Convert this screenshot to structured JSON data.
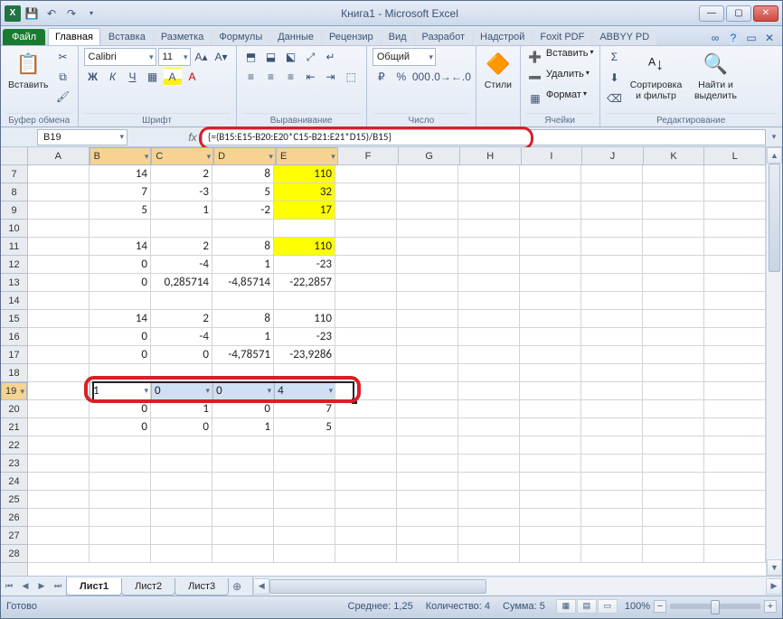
{
  "title": "Книга1 - Microsoft Excel",
  "app_icon_text": "X",
  "tabs": {
    "file": "Файл",
    "items": [
      "Главная",
      "Вставка",
      "Разметка",
      "Формулы",
      "Данные",
      "Рецензир",
      "Вид",
      "Разработ",
      "Надстрой",
      "Foxit PDF",
      "ABBYY PD"
    ],
    "active_index": 0
  },
  "ribbon": {
    "clipboard": {
      "paste": "Вставить",
      "label": "Буфер обмена"
    },
    "font": {
      "family": "Calibri",
      "size": "11",
      "label": "Шрифт"
    },
    "alignment": {
      "label": "Выравнивание"
    },
    "number": {
      "format": "Общий",
      "label": "Число"
    },
    "styles": {
      "btn": "Стили",
      "label": ""
    },
    "cells": {
      "insert": "Вставить",
      "delete": "Удалить",
      "format": "Формат",
      "label": "Ячейки"
    },
    "editing": {
      "sort": "Сортировка и фильтр",
      "find": "Найти и выделить",
      "label": "Редактирование"
    }
  },
  "namebox": "B19",
  "fx": "fx",
  "formula": "{=(B15:E15-B20:E20*C15-B21:E21*D15)/B15}",
  "columns": [
    "A",
    "B",
    "C",
    "D",
    "E",
    "F",
    "G",
    "H",
    "I",
    "J",
    "K",
    "L"
  ],
  "first_row": 7,
  "row_count": 22,
  "chart_data": {
    "type": "table",
    "selected_columns": [
      "B",
      "C",
      "D",
      "E"
    ],
    "selected_row_header": "19",
    "rows": {
      "7": {
        "B": "14",
        "C": "2",
        "D": "8",
        "E": "110",
        "E_yellow": true
      },
      "8": {
        "B": "7",
        "C": "-3",
        "D": "5",
        "E": "32",
        "E_yellow": true
      },
      "9": {
        "B": "5",
        "C": "1",
        "D": "-2",
        "E": "17",
        "E_yellow": true
      },
      "11": {
        "B": "14",
        "C": "2",
        "D": "8",
        "E": "110",
        "E_yellow": true
      },
      "12": {
        "B": "0",
        "C": "-4",
        "D": "1",
        "E": "-23"
      },
      "13": {
        "B": "0",
        "C": "0,285714",
        "D": "-4,85714",
        "E": "-22,2857"
      },
      "15": {
        "B": "14",
        "C": "2",
        "D": "8",
        "E": "110"
      },
      "16": {
        "B": "0",
        "C": "-4",
        "D": "1",
        "E": "-23"
      },
      "17": {
        "B": "0",
        "C": "0",
        "D": "-4,78571",
        "E": "-23,9286"
      },
      "19": {
        "B": "1",
        "C": "0",
        "D": "0",
        "E": "4",
        "selected": true
      },
      "20": {
        "B": "0",
        "C": "1",
        "D": "0",
        "E": "7"
      },
      "21": {
        "B": "0",
        "C": "0",
        "D": "1",
        "E": "5"
      }
    }
  },
  "sheets": {
    "items": [
      "Лист1",
      "Лист2",
      "Лист3"
    ],
    "active_index": 0
  },
  "status": {
    "ready": "Готово",
    "avg_lbl": "Среднее:",
    "avg_val": "1,25",
    "count_lbl": "Количество:",
    "count_val": "4",
    "sum_lbl": "Сумма:",
    "sum_val": "5",
    "zoom": "100%"
  }
}
